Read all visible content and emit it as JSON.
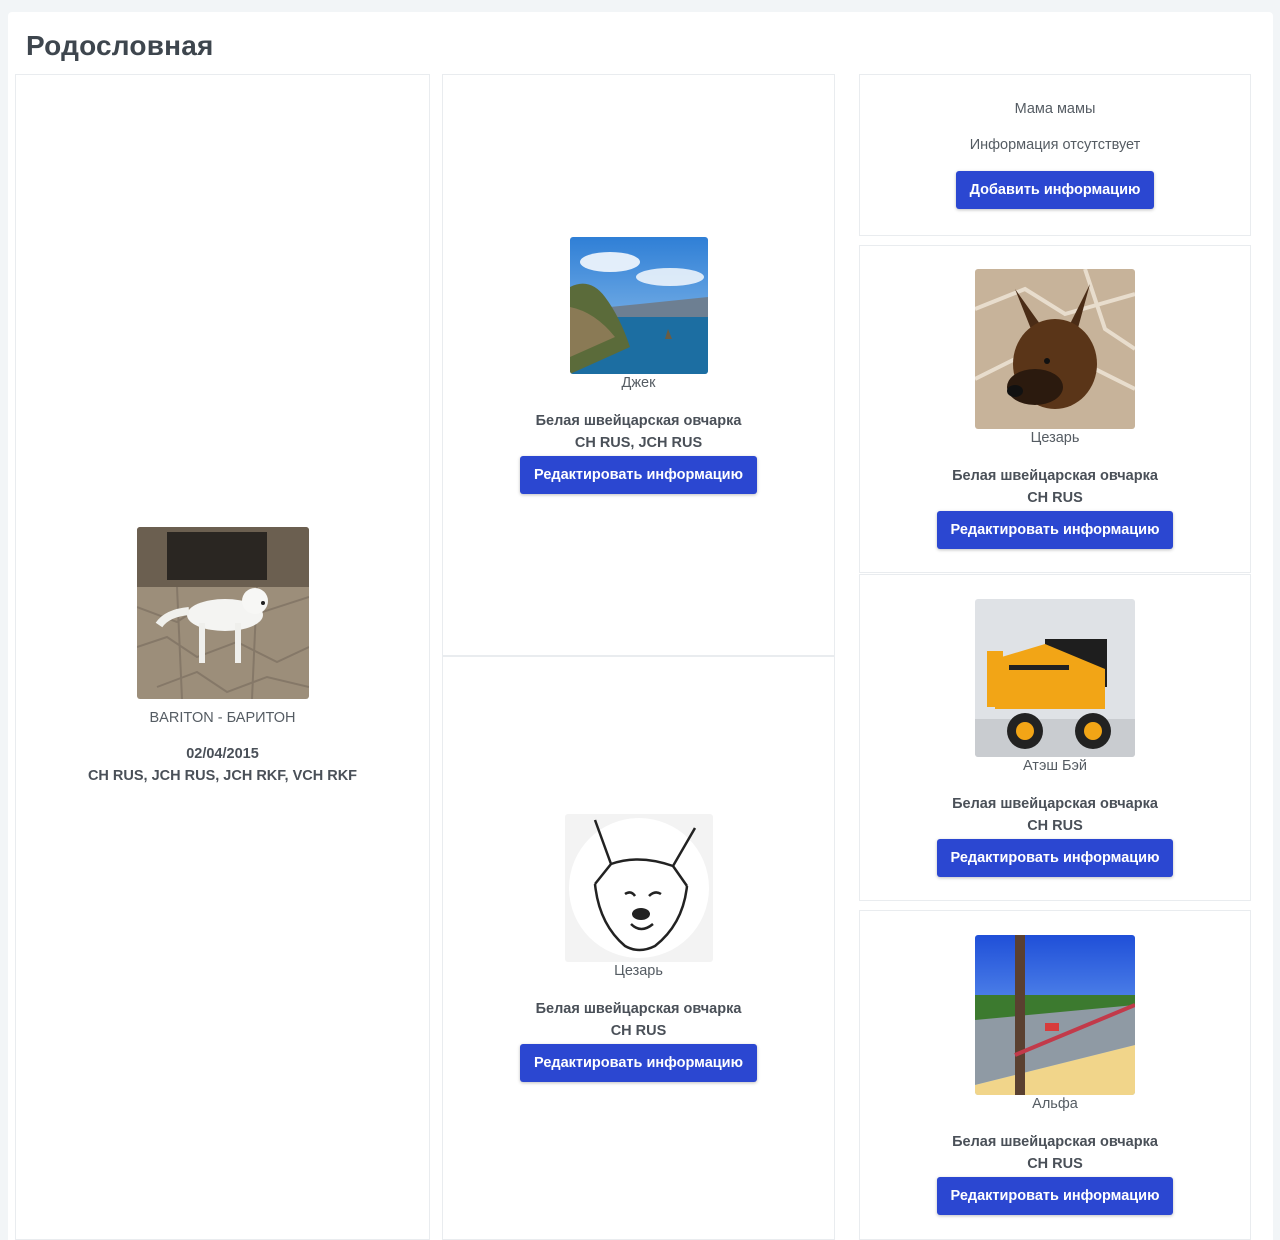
{
  "page": {
    "title": "Родословная"
  },
  "main_dog": {
    "name": "BARITON - БАРИТОН",
    "birth_date": "02/04/2015",
    "titles": "CH RUS, JCH RUS, JCH RKF, VCH RKF"
  },
  "parents": [
    {
      "name": "Джек",
      "breed": "Белая швейцарская овчарка",
      "titles": "CH RUS, JCH RUS",
      "button": "Редактировать информацию"
    },
    {
      "name": "Цезарь",
      "breed": "Белая швейцарская овчарка",
      "titles": "CH RUS",
      "button": "Редактировать информацию"
    }
  ],
  "grandparents": {
    "empty_slot": {
      "label": "Мама мамы",
      "message": "Информация отсутствует",
      "button": "Добавить информацию"
    },
    "items": [
      {
        "name": "Цезарь",
        "breed": "Белая швейцарская овчарка",
        "titles": "CH RUS",
        "button": "Редактировать информацию"
      },
      {
        "name": "Атэш Бэй",
        "breed": "Белая швейцарская овчарка",
        "titles": "CH RUS",
        "button": "Редактировать информацию"
      },
      {
        "name": "Альфа",
        "breed": "Белая швейцарская овчарка",
        "titles": "CH RUS",
        "button": "Редактировать информацию"
      }
    ]
  },
  "colors": {
    "accent": "#2b47d1",
    "background": "#f2f5f7"
  }
}
